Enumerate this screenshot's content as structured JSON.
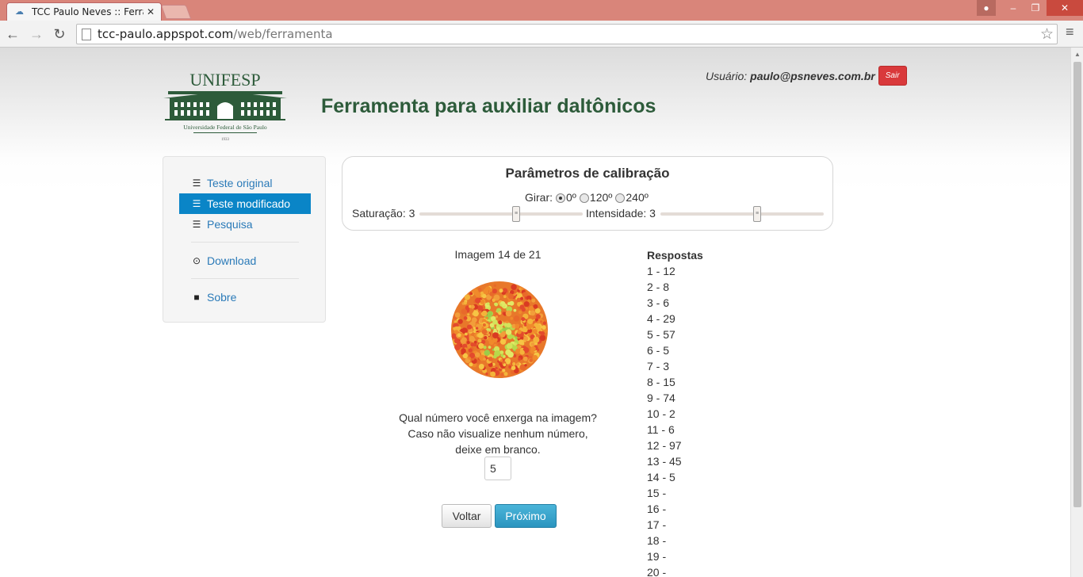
{
  "browser": {
    "tab_title": "TCC Paulo Neves :: Ferram",
    "url_host": "tcc-paulo.appspot.com",
    "url_path": "/web/ferramenta"
  },
  "header": {
    "logo_text": "UNIFESP",
    "logo_subtext": "Universidade Federal de São Paulo",
    "logo_year": "1933",
    "title": "Ferramenta para auxiliar daltônicos",
    "user_label": "Usuário:",
    "user_email": "paulo@psneves.com.br",
    "logout_label": "Sair"
  },
  "sidebar": {
    "items": [
      {
        "label": "Teste original",
        "icon": "list-icon",
        "active": false
      },
      {
        "label": "Teste modificado",
        "icon": "list-icon",
        "active": true
      },
      {
        "label": "Pesquisa",
        "icon": "list-icon",
        "active": false
      },
      {
        "label": "Download",
        "icon": "download-icon",
        "active": false
      },
      {
        "label": "Sobre",
        "icon": "book-icon",
        "active": false
      }
    ]
  },
  "calibration": {
    "title": "Parâmetros de calibração",
    "rotate_label": "Girar:",
    "rotate_options": [
      "0º",
      "120º",
      "240º"
    ],
    "rotate_selected": "0º",
    "saturation_label": "Saturação: 3",
    "saturation_value": 3,
    "intensity_label": "Intensidade: 3",
    "intensity_value": 3
  },
  "test": {
    "caption": "Imagem 14 de 21",
    "question": "Qual número você enxerga na imagem? Caso não visualize nenhum número, deixe em branco.",
    "answer_value": "5",
    "back_label": "Voltar",
    "next_label": "Próximo"
  },
  "answers": {
    "title": "Respostas",
    "items": [
      "1 - 12",
      "2 - 8",
      "3 - 6",
      "4 - 29",
      "5 - 57",
      "6 - 5",
      "7 - 3",
      "8 - 15",
      "9 - 74",
      "10 - 2",
      "11 - 6",
      "12 - 97",
      "13 - 45",
      "14 - 5",
      "15 -",
      "16 -",
      "17 -",
      "18 -",
      "19 -",
      "20 -"
    ]
  },
  "colors": {
    "title_green": "#2d5b3a",
    "active_blue": "#0a85c7",
    "link_blue": "#2a7ab8",
    "logout_red": "#d9393b",
    "chrome_red": "#d9857a"
  }
}
